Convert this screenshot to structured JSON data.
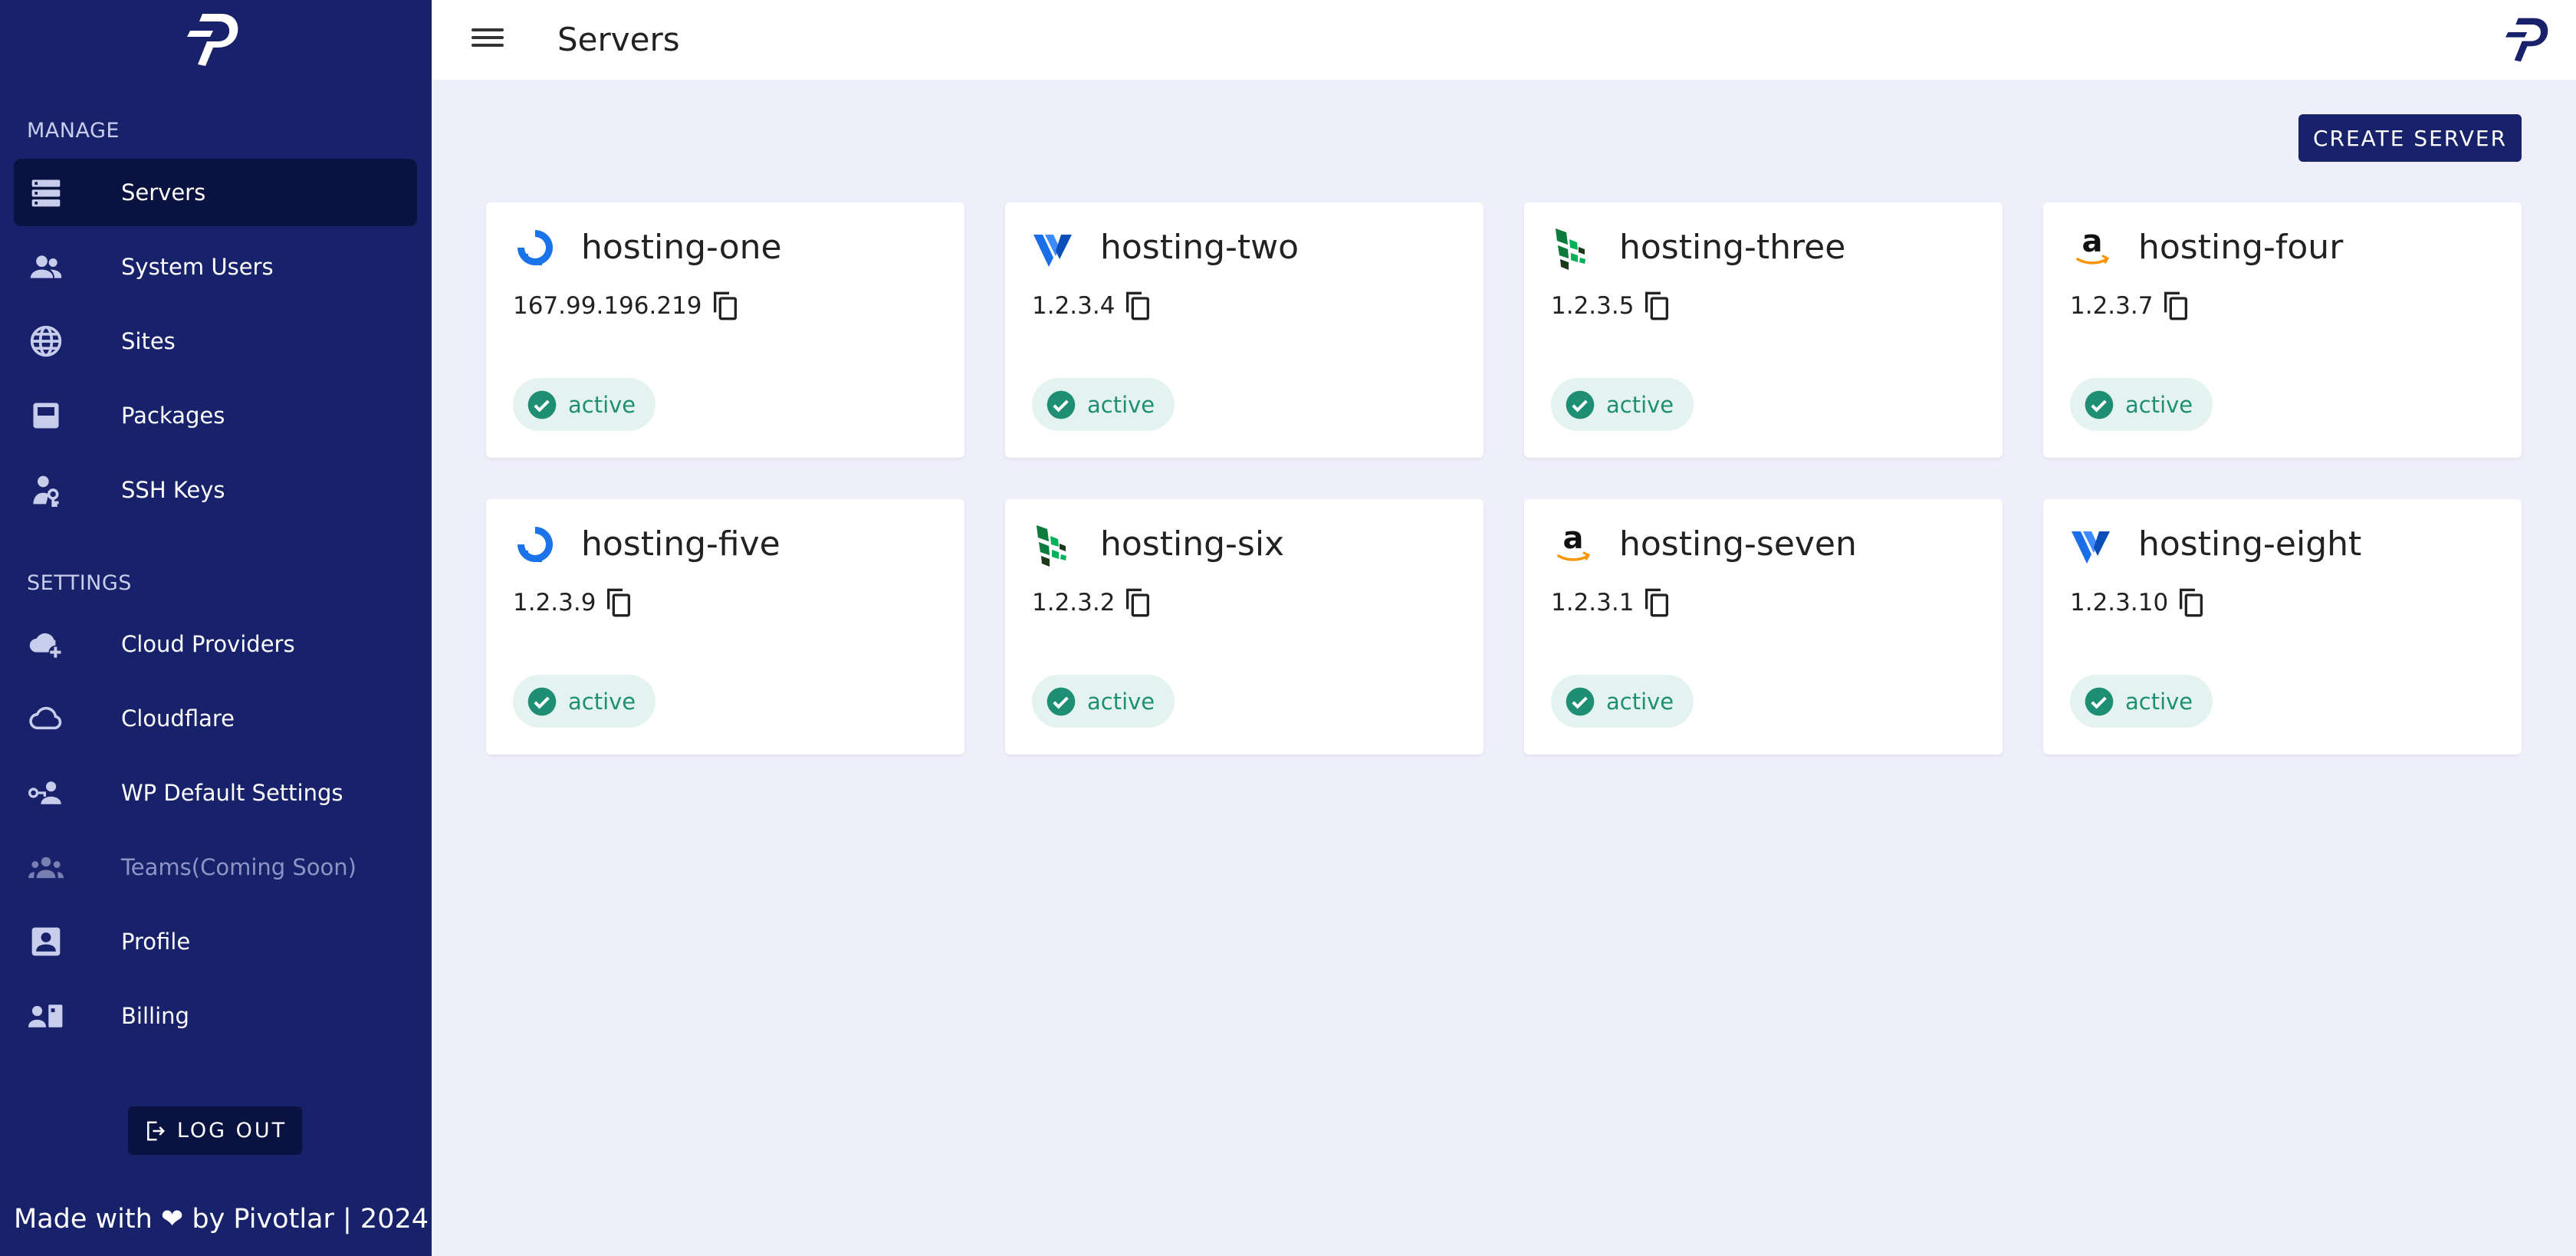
{
  "sidebar": {
    "sections": {
      "manage": "MANAGE",
      "settings": "SETTINGS"
    },
    "manage_items": [
      {
        "label": "Servers",
        "icon": "server-icon",
        "active": true
      },
      {
        "label": "System Users",
        "icon": "users-icon"
      },
      {
        "label": "Sites",
        "icon": "globe-icon"
      },
      {
        "label": "Packages",
        "icon": "package-icon"
      },
      {
        "label": "SSH Keys",
        "icon": "key-person-icon"
      }
    ],
    "settings_items": [
      {
        "label": "Cloud Providers",
        "icon": "cloud-plus-icon"
      },
      {
        "label": "Cloudflare",
        "icon": "cloud-icon"
      },
      {
        "label": "WP Default Settings",
        "icon": "person-key-icon"
      },
      {
        "label": "Teams(Coming Soon)",
        "icon": "team-icon",
        "disabled": true
      },
      {
        "label": "Profile",
        "icon": "profile-icon"
      },
      {
        "label": "Billing",
        "icon": "billing-icon"
      }
    ],
    "logout_label": "LOG OUT",
    "footer": "Made with ❤ by Pivotlar | 2024"
  },
  "header": {
    "title": "Servers"
  },
  "toolbar": {
    "create_label": "CREATE SERVER"
  },
  "servers": [
    {
      "name": "hosting-one",
      "ip": "167.99.196.219",
      "status": "active",
      "provider": "digitalocean"
    },
    {
      "name": "hosting-two",
      "ip": "1.2.3.4",
      "status": "active",
      "provider": "vultr"
    },
    {
      "name": "hosting-three",
      "ip": "1.2.3.5",
      "status": "active",
      "provider": "linode"
    },
    {
      "name": "hosting-four",
      "ip": "1.2.3.7",
      "status": "active",
      "provider": "amazon"
    },
    {
      "name": "hosting-five",
      "ip": "1.2.3.9",
      "status": "active",
      "provider": "digitalocean"
    },
    {
      "name": "hosting-six",
      "ip": "1.2.3.2",
      "status": "active",
      "provider": "linode"
    },
    {
      "name": "hosting-seven",
      "ip": "1.2.3.1",
      "status": "active",
      "provider": "amazon"
    },
    {
      "name": "hosting-eight",
      "ip": "1.2.3.10",
      "status": "active",
      "provider": "vultr"
    }
  ],
  "colors": {
    "sidebar_bg": "#18226a",
    "sidebar_active": "#0a1240",
    "page_bg": "#efeefb",
    "status_green": "#1e8f74",
    "status_bg": "#e4f3ef"
  }
}
